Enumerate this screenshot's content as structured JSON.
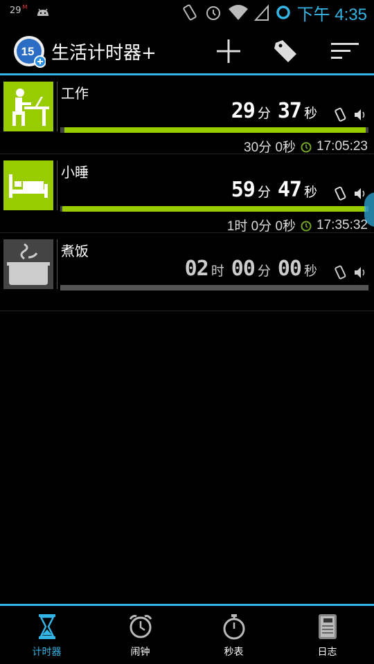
{
  "status_bar": {
    "notification_count": "29",
    "notification_sup": "M",
    "time": "下午 4:35"
  },
  "app_bar": {
    "badge_number": "15",
    "title": "生活计时器+"
  },
  "timers": [
    {
      "name": "工作",
      "countdown": [
        {
          "value": "29",
          "unit": "分"
        },
        {
          "value": "37",
          "unit": "秒"
        }
      ],
      "progress": 0.99,
      "duration": "30分 0秒",
      "end_time": "17:05:23",
      "icon": "desk-work-icon",
      "accent": "#99cc00"
    },
    {
      "name": "小睡",
      "countdown": [
        {
          "value": "59",
          "unit": "分"
        },
        {
          "value": "47",
          "unit": "秒"
        }
      ],
      "progress": 0.99,
      "duration": "1时 0分 0秒",
      "end_time": "17:35:32",
      "icon": "bed-icon",
      "accent": "#99cc00"
    },
    {
      "name": "煮饭",
      "countdown": [
        {
          "value": "02",
          "unit": "时"
        },
        {
          "value": "00",
          "unit": "分"
        },
        {
          "value": "00",
          "unit": "秒"
        }
      ],
      "progress": 0,
      "icon": "rice-cooker-icon",
      "accent": "#555555"
    }
  ],
  "tabs": [
    {
      "label": "计时器",
      "icon": "hourglass-icon",
      "active": true
    },
    {
      "label": "闹钟",
      "icon": "alarm-clock-icon",
      "active": false
    },
    {
      "label": "秒表",
      "icon": "stopwatch-icon",
      "active": false
    },
    {
      "label": "日志",
      "icon": "log-book-icon",
      "active": false
    }
  ],
  "colors": {
    "accent_blue": "#33b5e5",
    "progress_green": "#99cc00"
  }
}
